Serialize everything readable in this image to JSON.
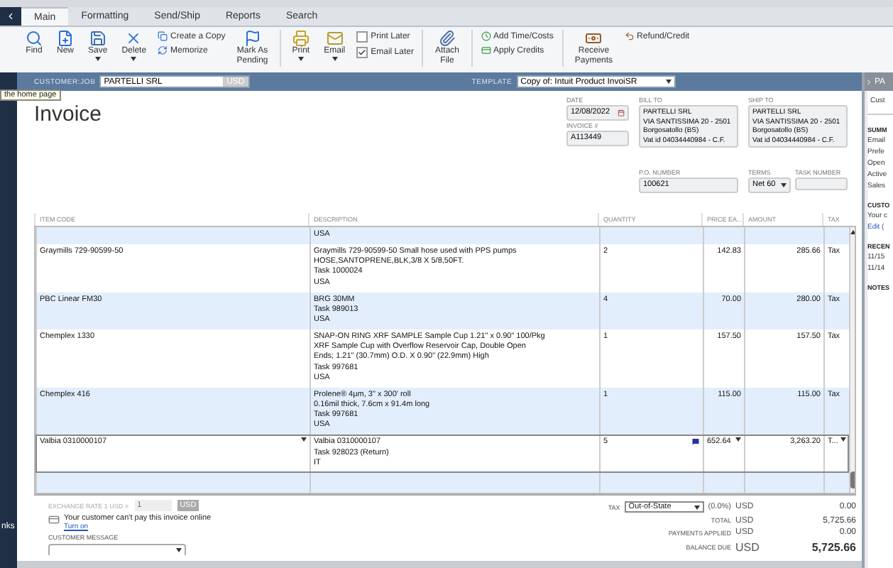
{
  "tabs": [
    {
      "label": "Main",
      "selected": true
    },
    {
      "label": "Formatting",
      "selected": false
    },
    {
      "label": "Send/Ship",
      "selected": false
    },
    {
      "label": "Reports",
      "selected": false
    },
    {
      "label": "Search",
      "selected": false
    }
  ],
  "toolbar": [
    {
      "kind": "big",
      "label": "Find"
    },
    {
      "kind": "big",
      "label": "New"
    },
    {
      "kind": "big",
      "label": "Save",
      "menu": true
    },
    {
      "kind": "big",
      "label": "Delete",
      "menu": true
    },
    {
      "kind": "pair",
      "items": [
        {
          "label": "Create a Copy"
        },
        {
          "label": "Memorize"
        }
      ]
    },
    {
      "kind": "big",
      "label": "Mark As\nPending"
    },
    {
      "kind": "sep"
    },
    {
      "kind": "big",
      "label": "Print",
      "menu": true
    },
    {
      "kind": "big",
      "label": "Email",
      "menu": true
    },
    {
      "kind": "checks",
      "items": [
        {
          "label": "Print Later",
          "checked": false
        },
        {
          "label": "Email Later",
          "checked": true
        }
      ]
    },
    {
      "kind": "sep"
    },
    {
      "kind": "big",
      "label": "Attach\nFile"
    },
    {
      "kind": "sep"
    },
    {
      "kind": "pair",
      "items": [
        {
          "label": "Add Time/Costs"
        },
        {
          "label": "Apply Credits"
        }
      ]
    },
    {
      "kind": "sep"
    },
    {
      "kind": "big",
      "label": "Receive\nPayments"
    },
    {
      "kind": "pair",
      "items": [
        {
          "label": "Refund/Credit"
        }
      ]
    }
  ],
  "customer_bar": {
    "customer_label": "CUSTOMER:JOB",
    "customer": "PARTELLI SRL",
    "currency": "USD",
    "template_label": "TEMPLATE",
    "template": "Copy of: Intuit Product InvoiSR"
  },
  "tooltip": "the home page",
  "sidebar_text": "nks",
  "form": {
    "title": "Invoice",
    "date_label": "DATE",
    "date": "12/08/2022",
    "invoice_label": "INVOICE #",
    "invoice": "A113449",
    "bill_to_label": "BILL TO",
    "bill_to": "PARTELLI SRL\nVIA SANTISSIMA 20 - 2501\nBorgosatollo (BS)\nVat id 04034440984 - C.F.",
    "ship_to_label": "SHIP TO",
    "ship_to": "PARTELLI SRL\nVIA SANTISSIMA 20 - 2501\nBorgosatollo (BS)\nVat id 04034440984 - C.F.",
    "po_label": "P.O. NUMBER",
    "po": "100621",
    "terms_label": "TERMS",
    "terms": "Net 60",
    "task_label": "TASK NUMBER"
  },
  "table": {
    "columns": [
      "ITEM CODE",
      "DESCRIPTION",
      "QUANTITY",
      "PRICE EA...",
      "AMOUNT",
      "TAX"
    ],
    "rows": [
      {
        "item": "",
        "description": "USA",
        "quantity": "",
        "price": "",
        "amount": "",
        "tax": "",
        "editing": false
      },
      {
        "item": "Graymills 729-90599-50",
        "description": "Graymills 729-90599-50 Small hose used with PPS pumps\nHOSE,SANTOPRENE,BLK,3/8 X 5/8,50FT.\nTask 1000024\nUSA",
        "quantity": "2",
        "price": "142.83",
        "amount": "285.66",
        "tax": "Tax",
        "editing": false
      },
      {
        "item": "PBC Linear FM30",
        "description": "BRG 30MM\nTask 989013\nUSA",
        "quantity": "4",
        "price": "70.00",
        "amount": "280.00",
        "tax": "Tax",
        "editing": false
      },
      {
        "item": "Chemplex 1330",
        "description": "SNAP-ON RING XRF SAMPLE Sample Cup 1.21\" x 0.90\" 100/Pkg\nXRF Sample Cup with Overflow Reservoir Cap, Double Open\nEnds; 1.21\" (30.7mm) O.D. X 0.90\" (22.9mm) High\nTask 997681\nUSA",
        "quantity": "1",
        "price": "157.50",
        "amount": "157.50",
        "tax": "Tax",
        "editing": false
      },
      {
        "item": "Chemplex 416",
        "description": "Prolene® 4µm, 3\" x 300' roll\n0.16mil thick, 7.6cm x 91.4m long\nTask 997681\nUSA",
        "quantity": "1",
        "price": "115.00",
        "amount": "115.00",
        "tax": "Tax",
        "editing": false
      },
      {
        "item": "Valbia 0310000107",
        "description": "Valbia 0310000107\nTask 928023 (Return)\nIT",
        "quantity": "5",
        "price": "652.64",
        "amount": "3,263.20",
        "tax": "T...",
        "editing": true
      }
    ]
  },
  "exchange": {
    "label": "EXCHANGE RATE 1 USD =",
    "value": "1",
    "currency": "USD"
  },
  "online": {
    "text": "Your customer can't pay this invoice online",
    "link": "Turn on"
  },
  "message_label": "CUSTOMER MESSAGE",
  "totals": {
    "tax_label": "TAX",
    "tax_item": "Out-of-State",
    "tax_rate": "(0.0%)",
    "lines": [
      {
        "currency": "USD",
        "value": "0.00",
        "kind": "tax"
      },
      {
        "label": "TOTAL",
        "currency": "USD",
        "value": "5,725.66",
        "kind": "plain"
      },
      {
        "label": "PAYMENTS APPLIED",
        "currency": "USD",
        "value": "0.00",
        "kind": "plain"
      },
      {
        "label": "BALANCE DUE",
        "currency": "USD",
        "value": "5,725.66",
        "kind": "big"
      }
    ]
  },
  "right_panel": {
    "header": "PA",
    "tab": "Cust",
    "summary": "SUMM",
    "summary_items": [
      "Email",
      "Prefe",
      "Open",
      "Active",
      "Sales"
    ],
    "customer": "CUSTO",
    "customer_text": "Your c",
    "edit_link": "Edit (",
    "recent": "RECEN",
    "recent_items": [
      "11/15",
      "11/14"
    ],
    "notes": "NOTES"
  }
}
